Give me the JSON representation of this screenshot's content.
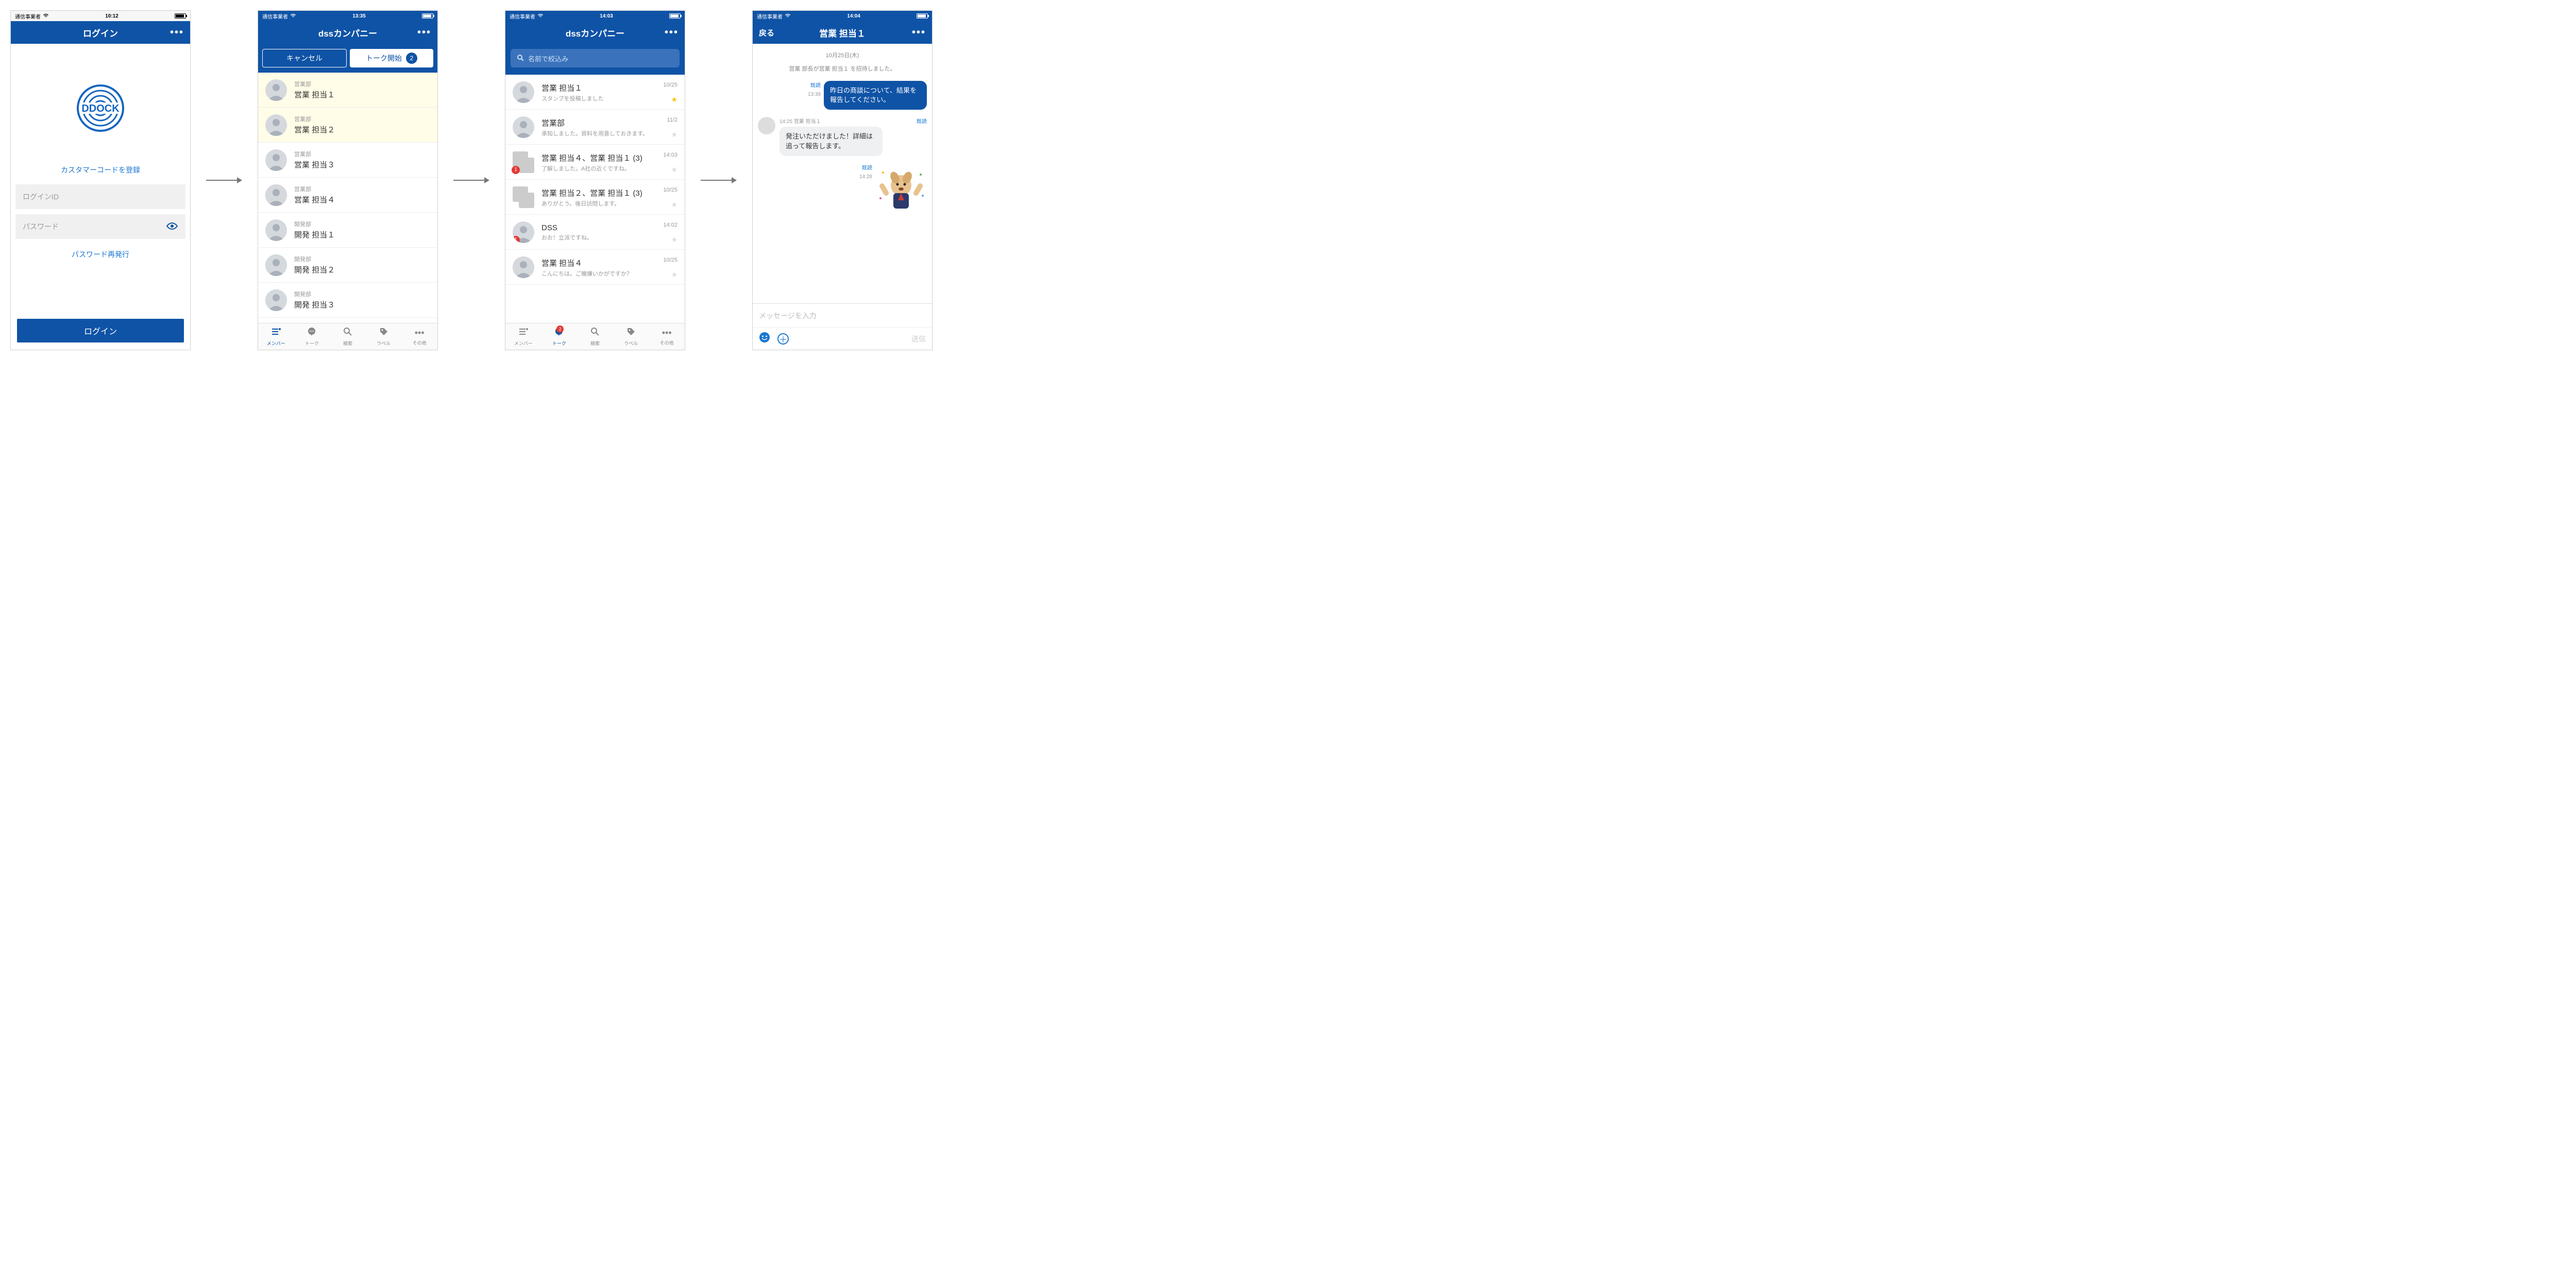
{
  "statusbar": {
    "carrier": "通信事業者"
  },
  "screen1": {
    "time": "10:12",
    "title": "ログイン",
    "logo_text": "DDOCK",
    "register_link": "カスタマーコードを登録",
    "login_id_placeholder": "ログインID",
    "password_placeholder": "パスワード",
    "pw_reissue": "パスワード再発行",
    "login_button": "ログイン"
  },
  "screen2": {
    "time": "13:35",
    "title": "dssカンパニー",
    "cancel": "キャンセル",
    "start_talk": "トーク開始",
    "selected_count": "2",
    "members": [
      {
        "dept": "営業部",
        "name": "営業 担当１",
        "selected": true
      },
      {
        "dept": "営業部",
        "name": "営業 担当２",
        "selected": true
      },
      {
        "dept": "営業部",
        "name": "営業 担当３",
        "selected": false
      },
      {
        "dept": "営業部",
        "name": "営業 担当４",
        "selected": false,
        "avatar": "red"
      },
      {
        "dept": "開発部",
        "name": "開発 担当１",
        "selected": false
      },
      {
        "dept": "開発部",
        "name": "開発 担当２",
        "selected": false,
        "avatar": "teal"
      },
      {
        "dept": "開発部",
        "name": "開発 担当３",
        "selected": false,
        "avatar": "blue"
      }
    ],
    "tabs": {
      "member": "メンバー",
      "talk": "トーク",
      "search": "検索",
      "label": "ラベル",
      "other": "その他"
    }
  },
  "screen3": {
    "time": "14:03",
    "title": "dssカンパニー",
    "search_placeholder": "名前で絞込み",
    "talks": [
      {
        "name": "営業 担当１",
        "sub": "スタンプを投稿しました",
        "date": "10/25",
        "star": true
      },
      {
        "name": "営業部",
        "sub": "承知しました。資料を用意しておきます。",
        "date": "11/2",
        "avatar": "gray"
      },
      {
        "name": "営業 担当４、営業 担当１ (3)",
        "sub": "了解しました。A社の近くですね。",
        "date": "14:03",
        "pair": true,
        "unread": "1"
      },
      {
        "name": "営業 担当２、営業 担当１ (3)",
        "sub": "ありがとう。後日訪問します。",
        "date": "10/25",
        "pair": true
      },
      {
        "name": "DSS",
        "sub": "おお！立派ですね。",
        "date": "14:02",
        "unread": "1"
      },
      {
        "name": "営業 担当４",
        "sub": "こんにちは。ご機嫌いかがですか？",
        "date": "10/25",
        "avatar": "red"
      }
    ],
    "tabs": {
      "member": "メンバー",
      "talk": "トーク",
      "search": "検索",
      "label": "ラベル",
      "other": "その他",
      "badge": "2"
    }
  },
  "screen4": {
    "time": "14:04",
    "back": "戻る",
    "title": "営業 担当１",
    "date_label": "10月25日(木)",
    "system": "営業 部長が営業 担当１ を招待しました。",
    "sent1": {
      "read": "既読",
      "time": "13:39",
      "text": "昨日の商談について、結果を報告してください。"
    },
    "recv1": {
      "time": "14:25",
      "sender": "営業 担当１",
      "read": "既読",
      "text": "発注いただけました！詳細は追って報告します。"
    },
    "stamp": {
      "read": "既読",
      "time": "14:28"
    },
    "input_placeholder": "メッセージを入力",
    "send": "送信"
  }
}
